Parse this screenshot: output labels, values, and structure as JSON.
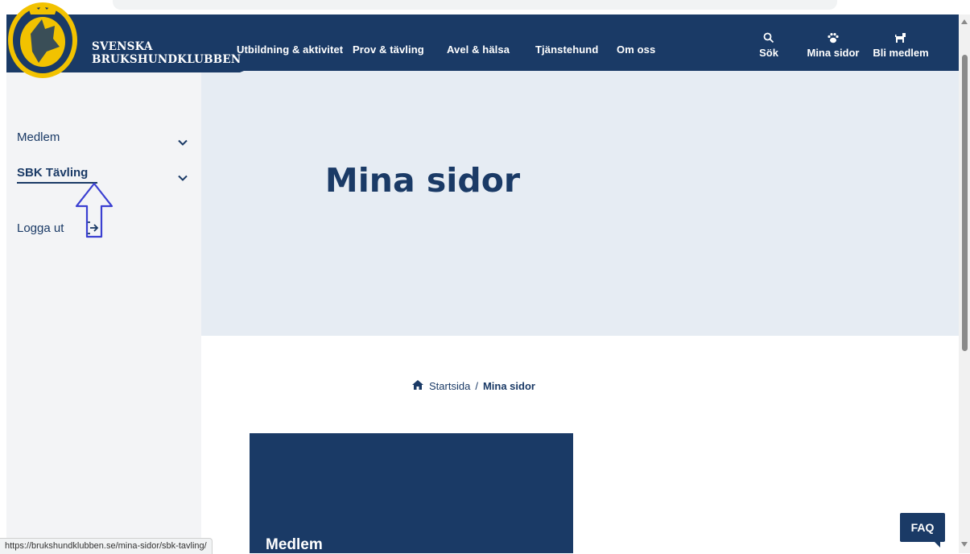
{
  "header": {
    "brand_line1": "SVENSKA",
    "brand_line2": "BRUKSHUNDKLUBBEN",
    "nav": [
      {
        "label": "Utbildning & aktivitet"
      },
      {
        "label": "Prov & tävling"
      },
      {
        "label": "Avel & hälsa"
      },
      {
        "label": "Tjänstehund"
      },
      {
        "label": "Om oss"
      }
    ],
    "icons": [
      {
        "label": "Sök",
        "icon": "search-icon"
      },
      {
        "label": "Mina sidor",
        "icon": "paw-icon"
      },
      {
        "label": "Bli medlem",
        "icon": "dog-icon"
      }
    ]
  },
  "sidebar": {
    "items": [
      {
        "label": "Medlem"
      },
      {
        "label": "SBK Tävling"
      }
    ],
    "logout": "Logga ut"
  },
  "hero": {
    "title": "Mina sidor"
  },
  "breadcrumb": {
    "home": "Startsida",
    "separator": "/",
    "current": "Mina sidor"
  },
  "card": {
    "title": "Medlem"
  },
  "faq": "FAQ",
  "status_url": "https://brukshundklubben.se/mina-sidor/sbk-tavling/",
  "colors": {
    "navy": "#1a3a66",
    "hero_bg": "#e6ecf3",
    "sidebar_bg": "#f3f4f6",
    "logo_yellow": "#f2c200",
    "annotation_arrow": "#3a3fd1"
  }
}
